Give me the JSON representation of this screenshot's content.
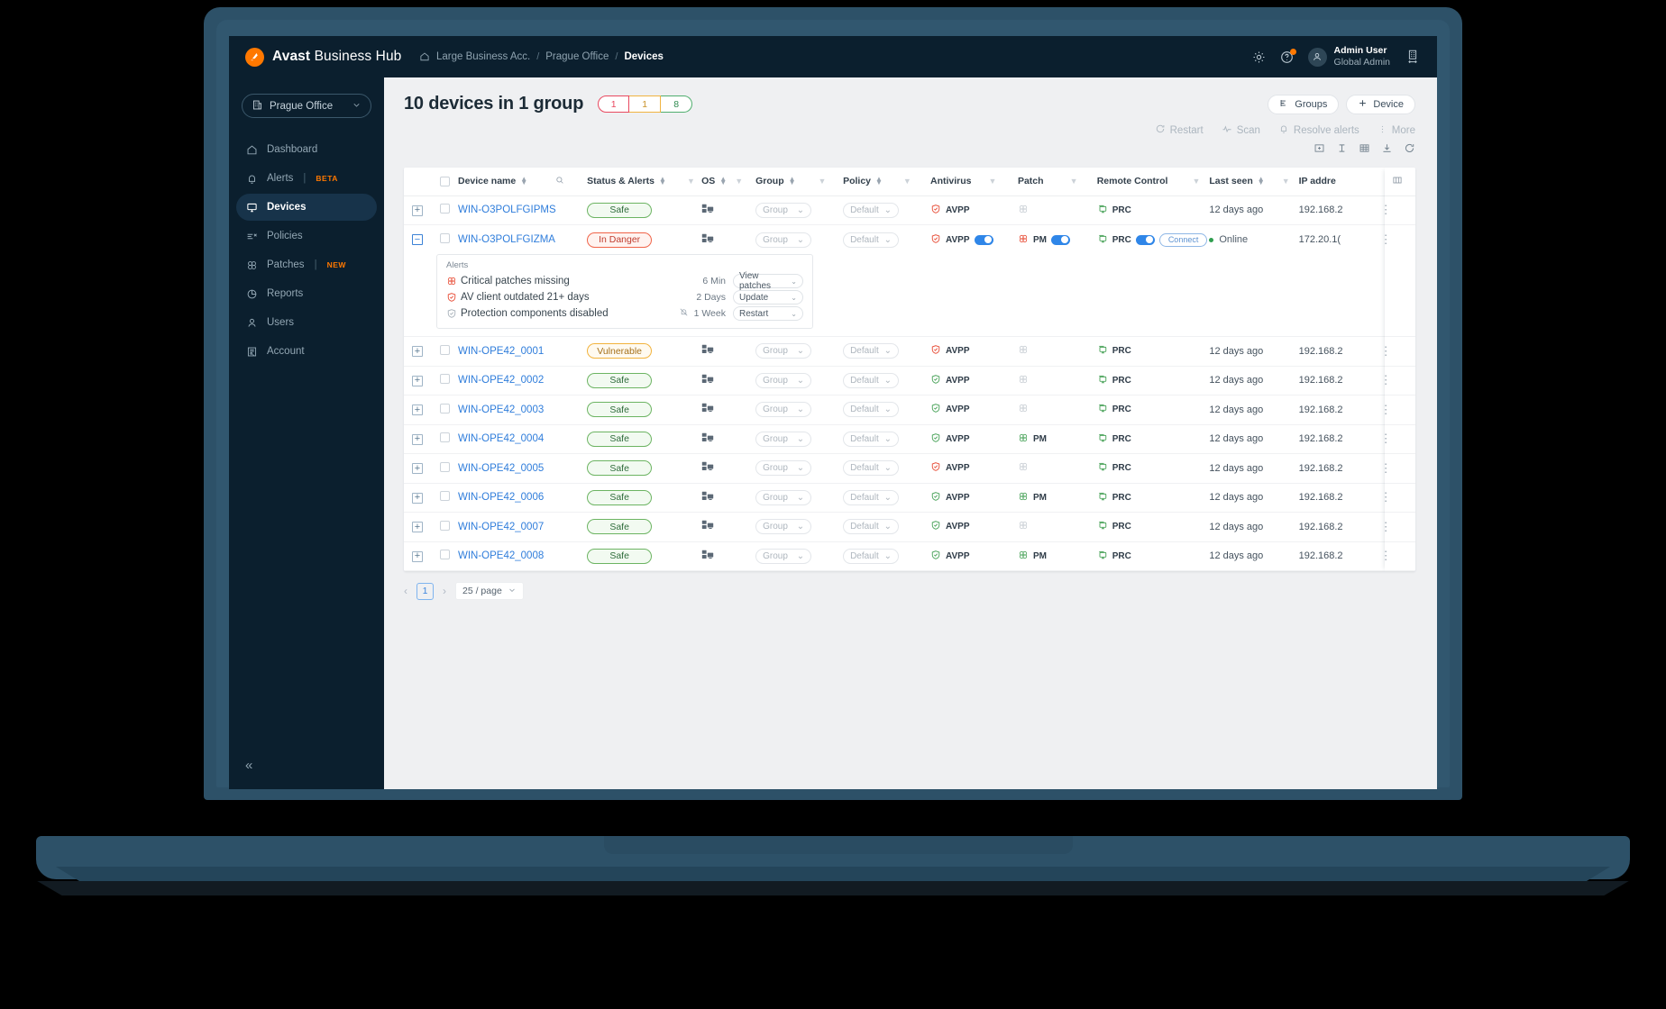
{
  "brand": {
    "bold": "Avast",
    "light": " Business Hub",
    "logo_icon": "avast-logo-icon"
  },
  "breadcrumb": {
    "home_icon": "home-icon",
    "items": [
      "Large Business Acc.",
      "Prague Office",
      "Devices"
    ],
    "separator": "/"
  },
  "topbar": {
    "settings_icon": "gear-icon",
    "help_icon": "help-circle-icon",
    "avatar_icon": "user-avatar-icon",
    "user_name": "Admin User",
    "user_role": "Global Admin",
    "switch_company_icon": "company-switch-icon"
  },
  "sidebar": {
    "office_selector": {
      "label": "Prague Office",
      "icon": "office-building-icon",
      "chevron": "chevron-down-icon"
    },
    "items": [
      {
        "label": "Dashboard",
        "icon": "home-icon",
        "active": false,
        "tag": ""
      },
      {
        "label": "Alerts",
        "icon": "bell-icon",
        "active": false,
        "tag": "BETA"
      },
      {
        "label": "Devices",
        "icon": "monitor-icon",
        "active": true,
        "tag": ""
      },
      {
        "label": "Policies",
        "icon": "policies-icon",
        "active": false,
        "tag": ""
      },
      {
        "label": "Patches",
        "icon": "patch-icon",
        "active": false,
        "tag": "NEW"
      },
      {
        "label": "Reports",
        "icon": "pie-chart-icon",
        "active": false,
        "tag": ""
      },
      {
        "label": "Users",
        "icon": "user-icon",
        "active": false,
        "tag": ""
      },
      {
        "label": "Account",
        "icon": "account-icon",
        "active": false,
        "tag": ""
      }
    ],
    "collapse": {
      "label": "«",
      "icon": "chevron-double-left-icon"
    }
  },
  "page": {
    "title": "10 devices in 1 group",
    "pills": [
      {
        "value": "1",
        "state": "danger",
        "color": "#e8485f"
      },
      {
        "value": "1",
        "state": "vulnerable",
        "color": "#f0b340"
      },
      {
        "value": "8",
        "state": "safe",
        "color": "#4fae6e"
      }
    ],
    "actions": [
      {
        "label": "Groups",
        "icon": "groups-icon"
      },
      {
        "label": "Device",
        "icon": "plus-icon"
      }
    ]
  },
  "toolbar": {
    "actions": [
      {
        "label": "Restart",
        "icon": "restart-icon"
      },
      {
        "label": "Scan",
        "icon": "scan-pulse-icon"
      },
      {
        "label": "Resolve alerts",
        "icon": "bell-icon"
      },
      {
        "label": "More",
        "icon": "kebab-icon"
      }
    ],
    "view_icons": [
      "expand-rows-icon",
      "row-height-icon",
      "grid-density-icon",
      "download-icon",
      "refresh-icon"
    ]
  },
  "table": {
    "columns": [
      {
        "label": "Device name",
        "sortable": true,
        "filter": "search-icon"
      },
      {
        "label": "Status & Alerts",
        "sortable": true,
        "filter": "filter-icon"
      },
      {
        "label": "OS",
        "sortable": true,
        "filter": "filter-icon"
      },
      {
        "label": "Group",
        "sortable": true,
        "filter": "filter-icon"
      },
      {
        "label": "Policy",
        "sortable": true,
        "filter": "filter-icon"
      },
      {
        "label": "Antivirus",
        "sortable": false,
        "filter": "filter-icon"
      },
      {
        "label": "Patch",
        "sortable": false,
        "filter": "filter-icon"
      },
      {
        "label": "Remote Control",
        "sortable": false,
        "filter": "filter-icon"
      },
      {
        "label": "Last seen",
        "sortable": true,
        "filter": "filter-icon"
      },
      {
        "label": "IP addre",
        "sortable": false,
        "filter": ""
      }
    ],
    "column_settings_icon": "columns-settings-icon",
    "group_placeholder": "Group",
    "policy_placeholder": "Default",
    "rows": [
      {
        "expand": "+",
        "name": "WIN-O3POLFGIPMS",
        "status": "Safe",
        "status_kind": "safe",
        "group": "Group",
        "policy": "Default",
        "av": {
          "label": "AVPP",
          "color": "red",
          "toggle": false
        },
        "patch": {
          "label": "",
          "color": "grey",
          "toggle": false
        },
        "prc": {
          "label": "PRC",
          "color": "green",
          "toggle": false,
          "connect": false
        },
        "last_seen": "12 days ago",
        "ip": "192.168.2"
      },
      {
        "expand": "−",
        "name": "WIN-O3POLFGIZMA",
        "status": "In Danger",
        "status_kind": "danger",
        "group": "Group",
        "policy": "Default",
        "av": {
          "label": "AVPP",
          "color": "red",
          "toggle": true
        },
        "patch": {
          "label": "PM",
          "color": "red",
          "toggle": true
        },
        "prc": {
          "label": "PRC",
          "color": "green",
          "toggle": true,
          "connect": true,
          "connect_label": "Connect"
        },
        "last_seen": "Online",
        "online": true,
        "ip": "172.20.1("
      },
      {
        "expand": "+",
        "name": "WIN-OPE42_0001",
        "status": "Vulnerable",
        "status_kind": "vuln",
        "group": "Group",
        "policy": "Default",
        "av": {
          "label": "AVPP",
          "color": "red",
          "toggle": false
        },
        "patch": {
          "label": "",
          "color": "grey",
          "toggle": false
        },
        "prc": {
          "label": "PRC",
          "color": "green",
          "toggle": false,
          "connect": false
        },
        "last_seen": "12 days ago",
        "ip": "192.168.2"
      },
      {
        "expand": "+",
        "name": "WIN-OPE42_0002",
        "status": "Safe",
        "status_kind": "safe",
        "group": "Group",
        "policy": "Default",
        "av": {
          "label": "AVPP",
          "color": "green",
          "toggle": false
        },
        "patch": {
          "label": "",
          "color": "grey",
          "toggle": false
        },
        "prc": {
          "label": "PRC",
          "color": "green",
          "toggle": false,
          "connect": false
        },
        "last_seen": "12 days ago",
        "ip": "192.168.2"
      },
      {
        "expand": "+",
        "name": "WIN-OPE42_0003",
        "status": "Safe",
        "status_kind": "safe",
        "group": "Group",
        "policy": "Default",
        "av": {
          "label": "AVPP",
          "color": "green",
          "toggle": false
        },
        "patch": {
          "label": "",
          "color": "grey",
          "toggle": false
        },
        "prc": {
          "label": "PRC",
          "color": "green",
          "toggle": false,
          "connect": false
        },
        "last_seen": "12 days ago",
        "ip": "192.168.2"
      },
      {
        "expand": "+",
        "name": "WIN-OPE42_0004",
        "status": "Safe",
        "status_kind": "safe",
        "group": "Group",
        "policy": "Default",
        "av": {
          "label": "AVPP",
          "color": "green",
          "toggle": false
        },
        "patch": {
          "label": "PM",
          "color": "green",
          "toggle": false
        },
        "prc": {
          "label": "PRC",
          "color": "green",
          "toggle": false,
          "connect": false
        },
        "last_seen": "12 days ago",
        "ip": "192.168.2"
      },
      {
        "expand": "+",
        "name": "WIN-OPE42_0005",
        "status": "Safe",
        "status_kind": "safe",
        "group": "Group",
        "policy": "Default",
        "av": {
          "label": "AVPP",
          "color": "red",
          "toggle": false
        },
        "patch": {
          "label": "",
          "color": "grey",
          "toggle": false
        },
        "prc": {
          "label": "PRC",
          "color": "green",
          "toggle": false,
          "connect": false
        },
        "last_seen": "12 days ago",
        "ip": "192.168.2"
      },
      {
        "expand": "+",
        "name": "WIN-OPE42_0006",
        "status": "Safe",
        "status_kind": "safe",
        "group": "Group",
        "policy": "Default",
        "av": {
          "label": "AVPP",
          "color": "green",
          "toggle": false
        },
        "patch": {
          "label": "PM",
          "color": "green",
          "toggle": false
        },
        "prc": {
          "label": "PRC",
          "color": "green",
          "toggle": false,
          "connect": false
        },
        "last_seen": "12 days ago",
        "ip": "192.168.2"
      },
      {
        "expand": "+",
        "name": "WIN-OPE42_0007",
        "status": "Safe",
        "status_kind": "safe",
        "group": "Group",
        "policy": "Default",
        "av": {
          "label": "AVPP",
          "color": "green",
          "toggle": false
        },
        "patch": {
          "label": "",
          "color": "grey",
          "toggle": false
        },
        "prc": {
          "label": "PRC",
          "color": "green",
          "toggle": false,
          "connect": false
        },
        "last_seen": "12 days ago",
        "ip": "192.168.2"
      },
      {
        "expand": "+",
        "name": "WIN-OPE42_0008",
        "status": "Safe",
        "status_kind": "safe",
        "group": "Group",
        "policy": "Default",
        "av": {
          "label": "AVPP",
          "color": "green",
          "toggle": false
        },
        "patch": {
          "label": "PM",
          "color": "green",
          "toggle": false
        },
        "prc": {
          "label": "PRC",
          "color": "green",
          "toggle": false,
          "connect": false
        },
        "last_seen": "12 days ago",
        "ip": "192.168.2"
      }
    ]
  },
  "alerts_panel": {
    "title": "Alerts",
    "rows": [
      {
        "icon": "patch-icon-red",
        "text": "Critical patches missing",
        "time": "6 Min",
        "muted": false,
        "action": "View patches"
      },
      {
        "icon": "shield-icon-red",
        "text": "AV client outdated 21+ days",
        "time": "2 Days",
        "muted": false,
        "action": "Update"
      },
      {
        "icon": "shield-icon-grey",
        "text": "Protection components disabled",
        "time": "1 Week",
        "muted": true,
        "action": "Restart"
      }
    ]
  },
  "pagination": {
    "prev": "‹",
    "next": "›",
    "current_page": "1",
    "page_size": "25 / page"
  }
}
